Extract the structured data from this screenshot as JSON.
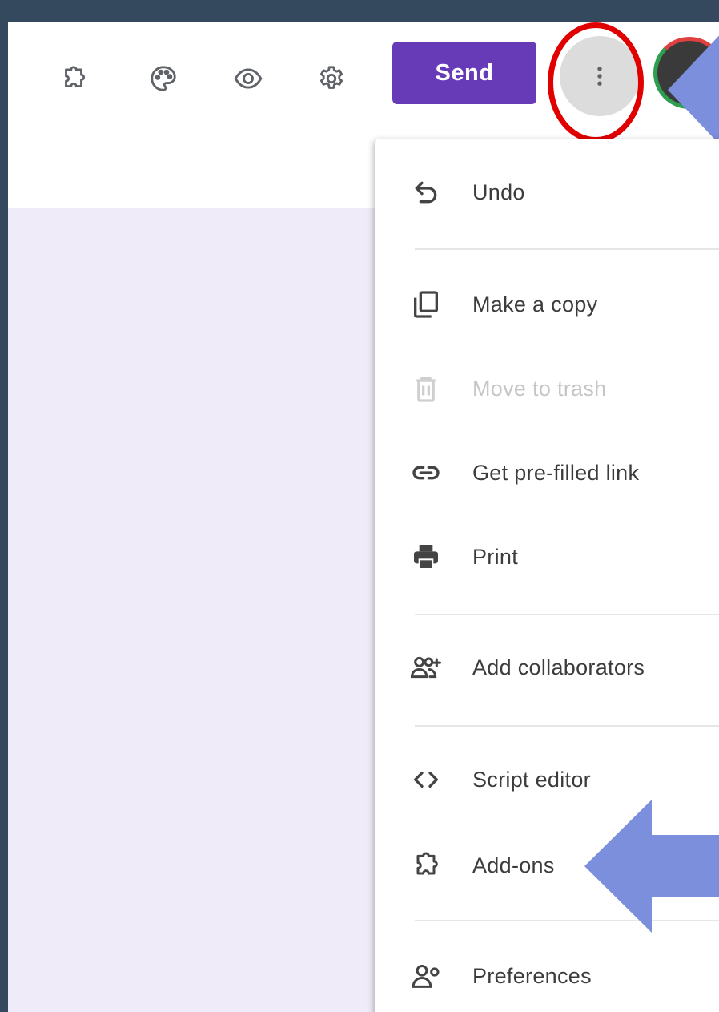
{
  "toolbar": {
    "icons": [
      "puzzle-icon",
      "palette-icon",
      "eye-icon",
      "gear-icon"
    ],
    "send_label": "Send",
    "more_icon": "more-vert-icon"
  },
  "menu": {
    "items": [
      {
        "label": "Undo",
        "icon": "undo-icon",
        "disabled": false
      },
      {
        "label": "Make a copy",
        "icon": "copy-icon",
        "disabled": false
      },
      {
        "label": "Move to trash",
        "icon": "trash-icon",
        "disabled": true
      },
      {
        "label": "Get pre-filled link",
        "icon": "link-icon",
        "disabled": false
      },
      {
        "label": "Print",
        "icon": "printer-icon",
        "disabled": false
      },
      {
        "label": "Add collaborators",
        "icon": "add-people-icon",
        "disabled": false
      },
      {
        "label": "Script editor",
        "icon": "code-icon",
        "disabled": false
      },
      {
        "label": "Add-ons",
        "icon": "puzzle-icon",
        "disabled": false
      },
      {
        "label": "Preferences",
        "icon": "person-settings-icon",
        "disabled": false
      }
    ]
  },
  "colors": {
    "backdrop": "#34495e",
    "canvas": "#f0ebf8",
    "brand": "#673ab7",
    "highlight_ring": "#e00000",
    "pointer_arrow": "#7b8fdc"
  }
}
